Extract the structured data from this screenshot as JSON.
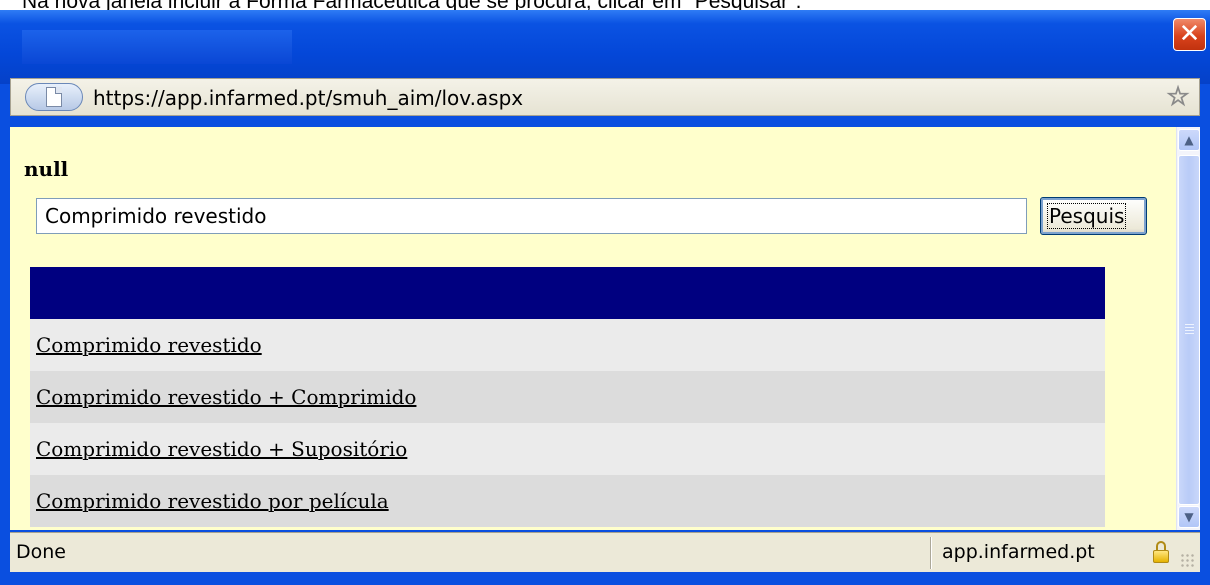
{
  "caption": "Na nova janela incluir a Forma Farmacêutica que se procura, clicar em \"Pesquisar\".",
  "window": {
    "title": "",
    "close_label": "✕"
  },
  "addressbar": {
    "url": "https://app.infarmed.pt/smuh_aim/lov.aspx"
  },
  "form": {
    "field_label": "null",
    "search_value": "Comprimido revestido",
    "search_button_label": "Pesquis"
  },
  "results": {
    "items": [
      "Comprimido revestido",
      "Comprimido revestido + Comprimido",
      "Comprimido revestido + Supositório",
      "Comprimido revestido por película"
    ]
  },
  "statusbar": {
    "status": "Done",
    "domain": "app.infarmed.pt"
  },
  "colors": {
    "title_bar": "#0447d8",
    "content_bg": "#ffffcc",
    "results_header": "#000080",
    "row_odd": "#ebebeb",
    "row_even": "#dcdcdc"
  },
  "icons": {
    "close": "close-icon",
    "page": "page-icon",
    "star": "star-icon",
    "lock": "lock-icon",
    "scroll_up": "chevron-up-icon",
    "scroll_down": "chevron-down-icon"
  }
}
